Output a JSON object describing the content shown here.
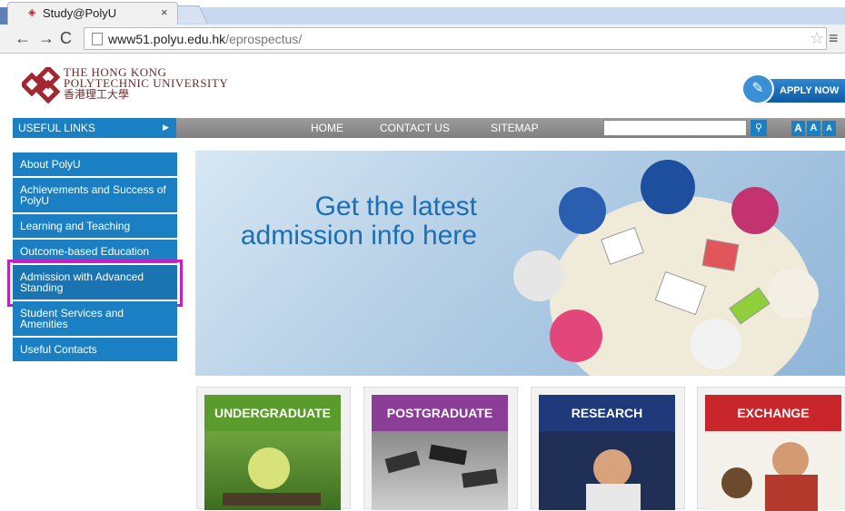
{
  "browser": {
    "tab_title": "Study@PolyU",
    "tab_close": "×",
    "url_host": "www51.polyu.edu.hk",
    "url_path": "/eprospectus/"
  },
  "header": {
    "logo_line1": "THE HONG KONG",
    "logo_line2": "POLYTECHNIC UNIVERSITY",
    "logo_line3": "香港理工大學",
    "apply_label": "APPLY NOW"
  },
  "navbar": {
    "useful_links": "USEFUL LINKS",
    "links": [
      "HOME",
      "CONTACT US",
      "SITEMAP"
    ],
    "font_sizes": [
      "A",
      "A",
      "A"
    ]
  },
  "sidebar": {
    "items": [
      {
        "label": "About PolyU"
      },
      {
        "label": "Achievements and Success of PolyU"
      },
      {
        "label": "Learning and Teaching"
      },
      {
        "label": "Outcome-based Education"
      },
      {
        "label": "Admission with Advanced Standing"
      },
      {
        "label": "Student Services and Amenities"
      },
      {
        "label": "Useful Contacts"
      }
    ]
  },
  "banner": {
    "line1": "Get the latest",
    "line2": "admission info here"
  },
  "tiles": [
    {
      "label": "UNDERGRADUATE",
      "color": "#5a9c2c"
    },
    {
      "label": "POSTGRADUATE",
      "color": "#8b3d98"
    },
    {
      "label": "RESEARCH",
      "color": "#1e3a7a"
    },
    {
      "label": "EXCHANGE",
      "color": "#c8262b"
    }
  ],
  "colors": {
    "accent": "#1b80c3",
    "highlight": "#c31fc3"
  }
}
